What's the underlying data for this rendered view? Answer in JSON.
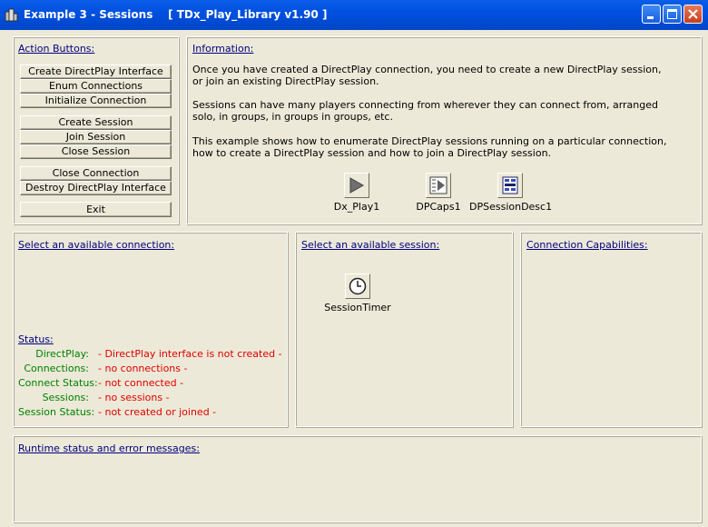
{
  "window": {
    "title": "Example 3 - Sessions    [ TDx_Play_Library v1.90 ]"
  },
  "actions": {
    "title": "Action Buttons:",
    "buttons": [
      "Create DirectPlay Interface",
      "Enum Connections",
      "Initialize Connection",
      "Create Session",
      "Join Session",
      "Close Session",
      "Close Connection",
      "Destroy DirectPlay Interface",
      "Exit"
    ]
  },
  "info": {
    "title": "Information:",
    "paragraphs": [
      "Once you have created a DirectPlay connection, you need to create a new DirectPlay session, or join an existing DirectPlay session.",
      "Sessions can have many players connecting from wherever they can connect from, arranged solo, in groups, in groups in groups, etc.",
      "This example shows how to enumerate DirectPlay sessions running on a particular connection, how to create a DirectPlay session and how to join a DirectPlay session."
    ],
    "components": [
      {
        "label": "Dx_Play1",
        "icon": "play-icon"
      },
      {
        "label": "DPCaps1",
        "icon": "caps-icon"
      },
      {
        "label": "DPSessionDesc1",
        "icon": "session-desc-icon"
      }
    ]
  },
  "connection": {
    "title": "Select an available connection:"
  },
  "status": {
    "title": "Status:",
    "rows": [
      {
        "label": "DirectPlay:",
        "value": "- DirectPlay interface is not created -"
      },
      {
        "label": "Connections:",
        "value": "- no connections -"
      },
      {
        "label": "Connect Status:",
        "value": "- not connected -"
      },
      {
        "label": "Sessions:",
        "value": "- no sessions -"
      },
      {
        "label": "Session Status:",
        "value": "- not created or joined -"
      }
    ],
    "label_color": "#008000",
    "value_color": "#e00000"
  },
  "session": {
    "title": "Select an available session:",
    "timer": {
      "label": "SessionTimer",
      "icon": "clock-icon"
    }
  },
  "caps": {
    "title": "Connection Capabilities:"
  },
  "runtime": {
    "title": "Runtime status and error messages:"
  },
  "colors": {
    "titlebar": "#0050e0",
    "link": "#000080",
    "background": "#ece9d8"
  }
}
